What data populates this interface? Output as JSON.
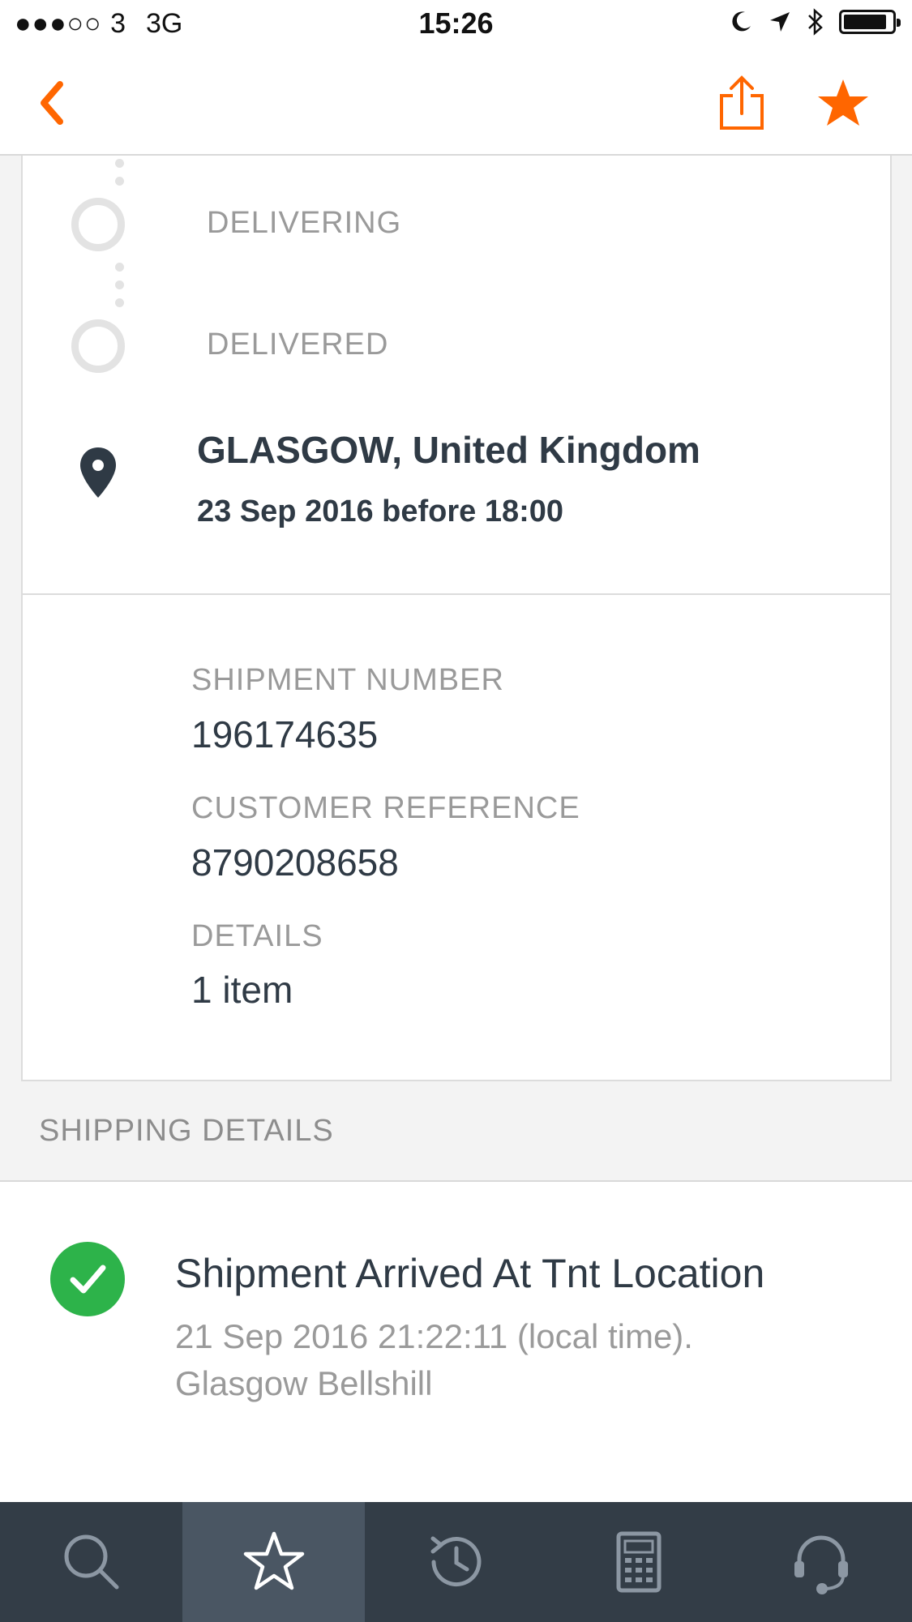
{
  "status_bar": {
    "signal": "●●●○○ 3",
    "network": "3G",
    "time": "15:26",
    "battery_level": 0.9
  },
  "nav": {
    "back_icon": "chevron-left-icon",
    "share_icon": "share-icon",
    "favorite_icon": "star-icon",
    "accent_color": "#ff6600"
  },
  "timeline": {
    "steps": [
      {
        "label": "DELIVERING",
        "state": "pending"
      },
      {
        "label": "DELIVERED",
        "state": "pending"
      }
    ]
  },
  "destination": {
    "location": "GLASGOW, United Kingdom",
    "estimated": "23 Sep 2016 before 18:00"
  },
  "shipment": {
    "number_label": "SHIPMENT NUMBER",
    "number_value": "196174635",
    "reference_label": "CUSTOMER REFERENCE",
    "reference_value": "8790208658",
    "details_label": "DETAILS",
    "details_value": "1 item"
  },
  "shipping_details": {
    "header": "SHIPPING DETAILS",
    "events": [
      {
        "title": "Shipment Arrived At Tnt Location",
        "timestamp": "21 Sep 2016 21:22:11 (local time).",
        "place": "Glasgow Bellshill",
        "status_color": "#2db34a"
      }
    ]
  },
  "tab_bar": {
    "tabs": [
      {
        "icon": "search-icon",
        "active": false
      },
      {
        "icon": "star-outline-icon",
        "active": true
      },
      {
        "icon": "history-icon",
        "active": false
      },
      {
        "icon": "calculator-icon",
        "active": false
      },
      {
        "icon": "headset-icon",
        "active": false
      }
    ]
  }
}
